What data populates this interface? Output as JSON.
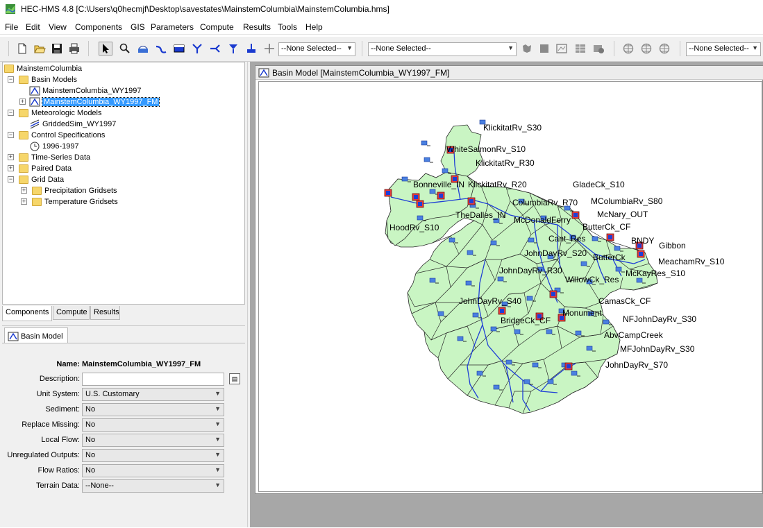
{
  "window": {
    "title": "HEC-HMS 4.8 [C:\\Users\\q0hecmjf\\Desktop\\savestates\\MainstemColumbia\\MainstemColumbia.hms]"
  },
  "menu": [
    "File",
    "Edit",
    "View",
    "Components",
    "GIS",
    "Parameters",
    "Compute",
    "Results",
    "Tools",
    "Help"
  ],
  "toolbar": {
    "combo1": "--None Selected--",
    "combo2": "--None Selected--",
    "combo3": "--None Selected--",
    "icons": [
      "new-file-icon",
      "open-folder-icon",
      "save-icon",
      "print-icon",
      "arrow-select-icon",
      "zoom-icon",
      "subbasin-tool-icon",
      "reach-tool-icon",
      "reservoir-tool-icon",
      "junction-tool-icon",
      "diversion-tool-icon",
      "source-tool-icon",
      "sink-tool-icon",
      "crosshair-icon"
    ]
  },
  "tree": {
    "root": "MainstemColumbia",
    "basin_models": "Basin Models",
    "basin1": "MainstemColumbia_WY1997",
    "basin2": "MainstemColumbia_WY1997_FM",
    "met_models": "Meteorologic Models",
    "met1": "GriddedSim_WY1997",
    "control_specs": "Control Specifications",
    "control1": "1996-1997",
    "time_series": "Time-Series Data",
    "paired": "Paired Data",
    "grid": "Grid Data",
    "precip_grids": "Precipitation Gridsets",
    "temp_grids": "Temperature Gridsets"
  },
  "tabs": [
    "Components",
    "Compute",
    "Results"
  ],
  "props": {
    "tab": "Basin Model",
    "name_label": "Name:",
    "name_value": "MainstemColumbia_WY1997_FM",
    "fields": [
      {
        "label": "Description:",
        "value": ""
      },
      {
        "label": "Unit System:",
        "value": "U.S. Customary"
      },
      {
        "label": "Sediment:",
        "value": "No"
      },
      {
        "label": "Replace Missing:",
        "value": "No"
      },
      {
        "label": "Local Flow:",
        "value": "No"
      },
      {
        "label": "Unregulated Outputs:",
        "value": "No"
      },
      {
        "label": "Flow Ratios:",
        "value": "No"
      },
      {
        "label": "Terrain Data:",
        "value": "--None--"
      }
    ]
  },
  "basin_window": {
    "title": "Basin Model [MainstemColumbia_WY1997_FM]",
    "labels": [
      "KlickitatRv_S30",
      "WhiteSalmonRv_S10",
      "KlickitatRv_R30",
      "Bonneville_IN",
      "KlickitatRv_R20",
      "GladeCk_S10",
      "ColumbiaRv_R70",
      "MColumbiaRv_S80",
      "McNary_OUT",
      "TheDalles_IN",
      "McDonaldFerry",
      "ButterCk_CF",
      "HoodRv_S10",
      "Cant_Res",
      "BNDY",
      "Gibbon",
      "JohnDayRv_S20",
      "ButterCk",
      "MeachamRv_S10",
      "JohnDayRv_R30",
      "WillowCk_Res",
      "McKayRes_S10",
      "JohnDayRv_S40",
      "CamasCk_CF",
      "Monument",
      "BridgeCk_CF",
      "NFJohnDayRv_S30",
      "AbvCampCreek",
      "MFJohnDayRv_S30",
      "JohnDayRv_S70"
    ]
  },
  "colors": {
    "selection": "#3399ff",
    "basin_fill": "#c9f5c3",
    "reach": "#1f3fd6",
    "desktop": "#a7a7a7"
  }
}
